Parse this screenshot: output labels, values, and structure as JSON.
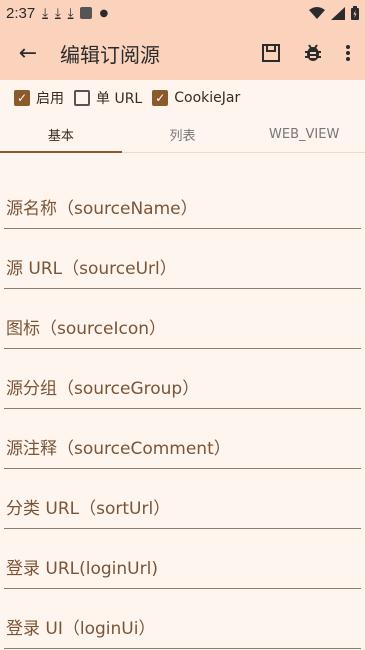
{
  "status": {
    "time": "2:37"
  },
  "appbar": {
    "title": "编辑订阅源"
  },
  "checkboxes": [
    {
      "label": "启用",
      "checked": true
    },
    {
      "label": "单 URL",
      "checked": false
    },
    {
      "label": "CookieJar",
      "checked": true
    }
  ],
  "tabs": [
    {
      "label": "基本",
      "active": true
    },
    {
      "label": "列表",
      "active": false
    },
    {
      "label": "WEB_VIEW",
      "active": false
    }
  ],
  "fields": [
    {
      "label": "源名称（sourceName）"
    },
    {
      "label": "源 URL（sourceUrl）"
    },
    {
      "label": "图标（sourceIcon）"
    },
    {
      "label": "源分组（sourceGroup）"
    },
    {
      "label": "源注释（sourceComment）"
    },
    {
      "label": "分类 URL（sortUrl）"
    },
    {
      "label": "登录 URL(loginUrl)"
    },
    {
      "label": "登录 UI（loginUi）"
    }
  ],
  "colors": {
    "appbar": "#fbd3bd",
    "accent": "#8a5a2b",
    "background": "#fff5ef"
  }
}
